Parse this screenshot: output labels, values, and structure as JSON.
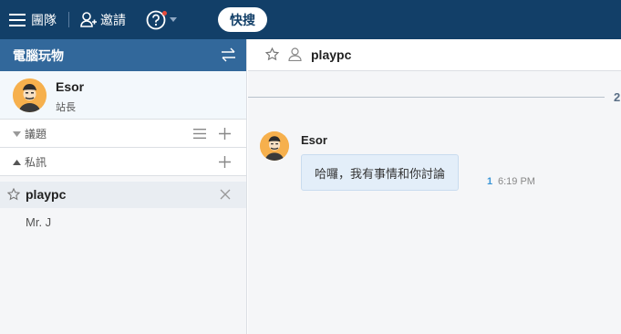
{
  "topbar": {
    "team_label": "團隊",
    "invite_label": "邀請",
    "quick_search_label": "快搜"
  },
  "sidebar": {
    "title": "電腦玩物",
    "user": {
      "name": "Esor",
      "role": "站長"
    },
    "sections": [
      {
        "label": "議題"
      },
      {
        "label": "私訊"
      }
    ],
    "conversations": [
      {
        "name": "playpc",
        "active": true
      },
      {
        "name": "Mr. J",
        "active": false
      }
    ]
  },
  "main": {
    "channel_name": "playpc",
    "date_divider": "2",
    "messages": [
      {
        "author": "Esor",
        "text": "哈囉，我有事情和你討論",
        "read_count": "1",
        "time": "6:19 PM"
      }
    ]
  },
  "colors": {
    "topbar_bg": "#123f68",
    "sidebar_header_bg": "#32689b",
    "bubble_bg": "#e3eef9",
    "avatar_bg": "#f6b04d"
  }
}
